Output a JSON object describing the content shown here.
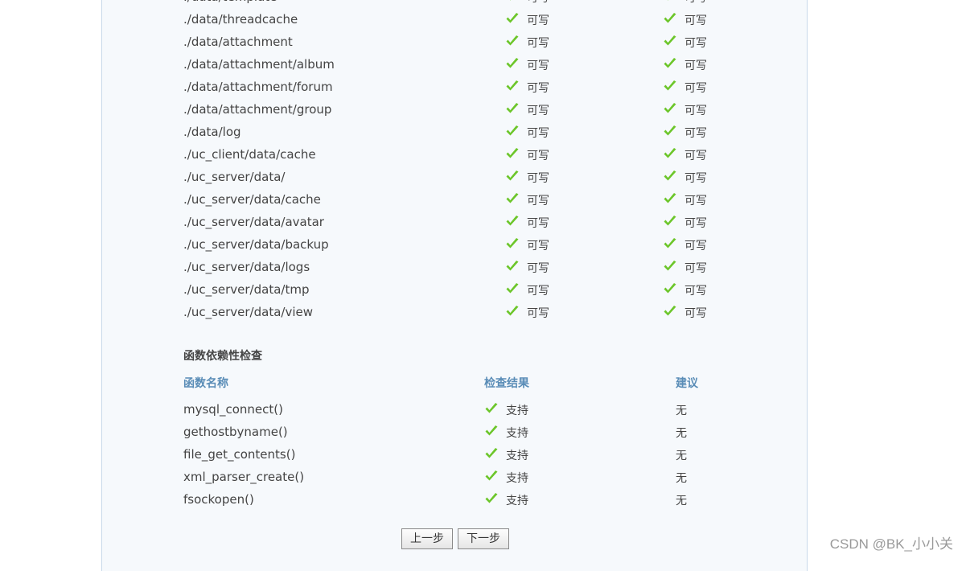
{
  "directories": [
    "./data/template",
    "./data/threadcache",
    "./data/attachment",
    "./data/attachment/album",
    "./data/attachment/forum",
    "./data/attachment/group",
    "./data/log",
    "./uc_client/data/cache",
    "./uc_server/data/",
    "./uc_server/data/cache",
    "./uc_server/data/avatar",
    "./uc_server/data/backup",
    "./uc_server/data/logs",
    "./uc_server/data/tmp",
    "./uc_server/data/view"
  ],
  "dir_status": "可写",
  "functions_section": {
    "title": "函数依赖性检查",
    "headers": [
      "函数名称",
      "检查结果",
      "建议"
    ],
    "rows": [
      {
        "name": "mysql_connect()",
        "result": "支持",
        "advice": "无"
      },
      {
        "name": "gethostbyname()",
        "result": "支持",
        "advice": "无"
      },
      {
        "name": "file_get_contents()",
        "result": "支持",
        "advice": "无"
      },
      {
        "name": "xml_parser_create()",
        "result": "支持",
        "advice": "无"
      },
      {
        "name": "fsockopen()",
        "result": "支持",
        "advice": "无"
      }
    ]
  },
  "buttons": {
    "prev": "上一步",
    "next": "下一步"
  },
  "watermark": "CSDN @BK_小小关",
  "colors": {
    "check": "#6cc62a",
    "header": "#5a8db7",
    "panel": "#f6f9fc"
  }
}
